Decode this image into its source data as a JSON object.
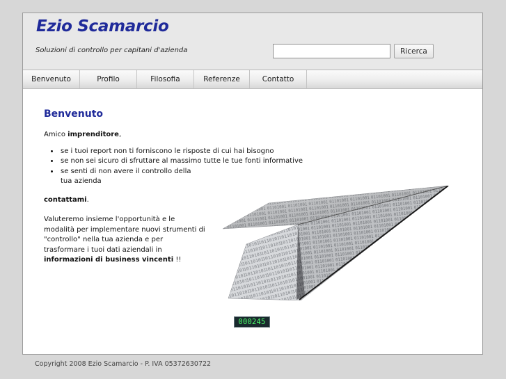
{
  "header": {
    "title": "Ezio Scamarcio",
    "tagline": "Soluzioni di controllo per capitani d'azienda",
    "search": {
      "value": "",
      "placeholder": "",
      "button_label": "Ricerca"
    }
  },
  "nav": {
    "items": [
      {
        "label": "Benvenuto"
      },
      {
        "label": "Profilo"
      },
      {
        "label": "Filosofia"
      },
      {
        "label": "Referenze"
      },
      {
        "label": "Contatto"
      }
    ]
  },
  "content": {
    "heading": "Benvenuto",
    "intro_prefix": "Amico ",
    "intro_bold": "imprenditore",
    "intro_suffix": ",",
    "bullets": [
      "se i tuoi report non ti forniscono le risposte di cui hai bisogno",
      "se non sei sicuro di sfruttare al massimo tutte le tue fonti informative",
      "se senti di non avere il controllo della tua azienda"
    ],
    "contact_bold": "contattami",
    "contact_suffix": ".",
    "paragraph_text": "Valuteremo insieme l'opportunità e le modalità per implementare nuovi strumenti di \"controllo\" nella tua azienda e per trasformare i tuoi dati aziendali in ",
    "paragraph_bold": "informazioni di business vincenti",
    "paragraph_suffix": " !!"
  },
  "counter": {
    "value": "000245"
  },
  "footer": {
    "text": "Copyright 2008 Ezio Scamarcio - P. IVA 05372630722"
  },
  "image": {
    "icon": "paper-airplane-binary-image"
  }
}
